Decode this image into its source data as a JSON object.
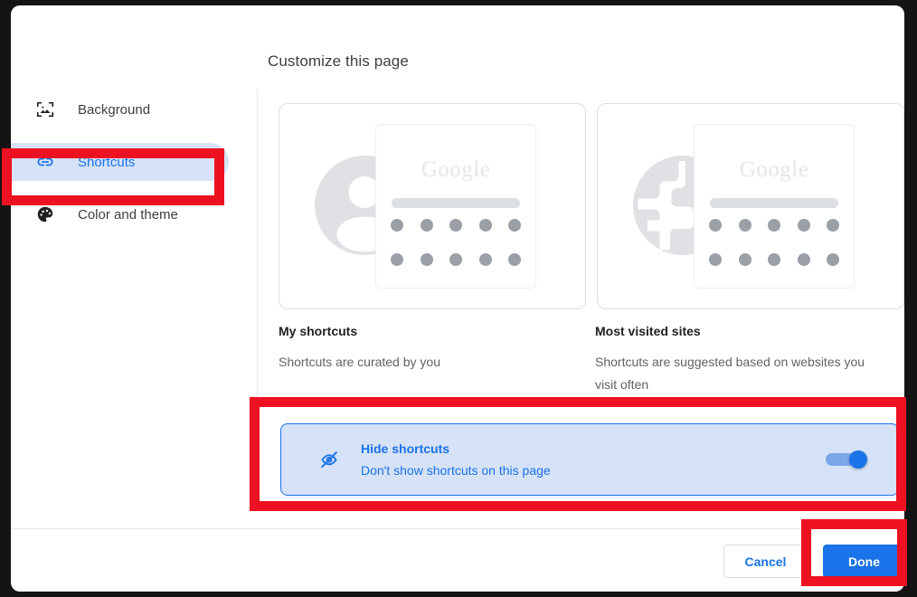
{
  "dialog": {
    "title": "Customize this page"
  },
  "sidebar": {
    "items": [
      {
        "label": "Background",
        "icon": "image-icon",
        "selected": false
      },
      {
        "label": "Shortcuts",
        "icon": "link-icon",
        "selected": true
      },
      {
        "label": "Color and theme",
        "icon": "palette-icon",
        "selected": false
      }
    ]
  },
  "options": [
    {
      "title": "My shortcuts",
      "description": "Shortcuts are curated by you",
      "preview_icon": "person-icon",
      "preview_logo": "Google",
      "selected": false
    },
    {
      "title": "Most visited sites",
      "description": "Shortcuts are suggested based on websites you visit often",
      "preview_icon": "globe-icon",
      "preview_logo": "Google",
      "selected": false
    }
  ],
  "hide_shortcuts": {
    "icon": "eye-off-icon",
    "title": "Hide shortcuts",
    "subtitle": "Don't show shortcuts on this page",
    "toggle_on": true
  },
  "footer": {
    "cancel_label": "Cancel",
    "done_label": "Done"
  },
  "colors": {
    "accent": "#1a73e8",
    "selected_bg": "#d6e2f7",
    "annotation": "#ee1122",
    "text_primary": "#202124",
    "text_secondary": "#5f6368",
    "border": "#dadce0",
    "backdrop": "#141414"
  }
}
